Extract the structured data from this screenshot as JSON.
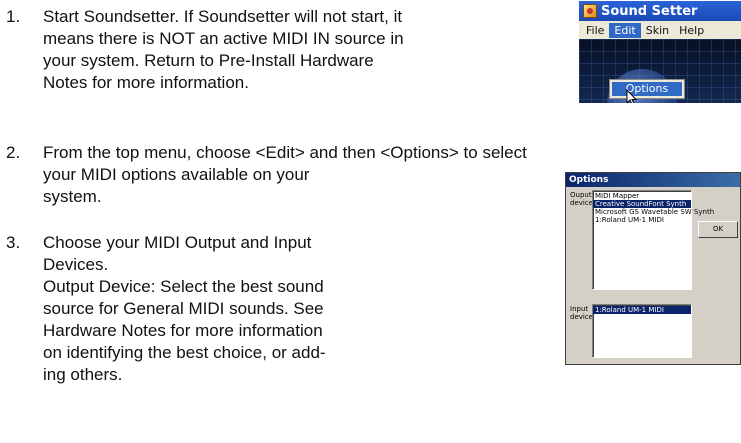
{
  "steps": [
    {
      "number": "1.",
      "lines": [
        "Start Soundsetter.  If Soundsetter will not start, it",
        "means there is NOT an active MIDI IN source in",
        "your system.  Return to Pre-Install Hardware",
        "Notes for more information."
      ]
    },
    {
      "number": "2.",
      "lines": [
        "From the top menu, choose <Edit> and then <Options> to select",
        "your MIDI options available on your",
        "system."
      ]
    },
    {
      "number": "3.",
      "lines": [
        "Choose your MIDI Output and Input",
        "Devices.",
        "Output Device:  Select the best sound",
        "source for General MIDI sounds.  See",
        "Hardware Notes for more information",
        "on identifying the best choice, or add-",
        "ing others."
      ]
    }
  ],
  "sound_setter": {
    "title": "Sound Setter",
    "menu": [
      "File",
      "Edit",
      "Skin",
      "Help"
    ],
    "active_menu": "Edit",
    "dropdown_item": "Options"
  },
  "options_dialog": {
    "title": "Options",
    "output_label_1": "Ouput",
    "output_label_2": "device",
    "output_items": [
      "MIDI Mapper",
      "Creative SoundFont Synth",
      "Microsoft GS Wavetable SW Synth",
      "1:Roland UM-1 MIDI"
    ],
    "output_selected": 1,
    "input_label_1": "Input",
    "input_label_2": "device",
    "input_items": [
      "1:Roland UM-1 MIDI"
    ],
    "input_selected": 0,
    "ok_label": "OK"
  }
}
